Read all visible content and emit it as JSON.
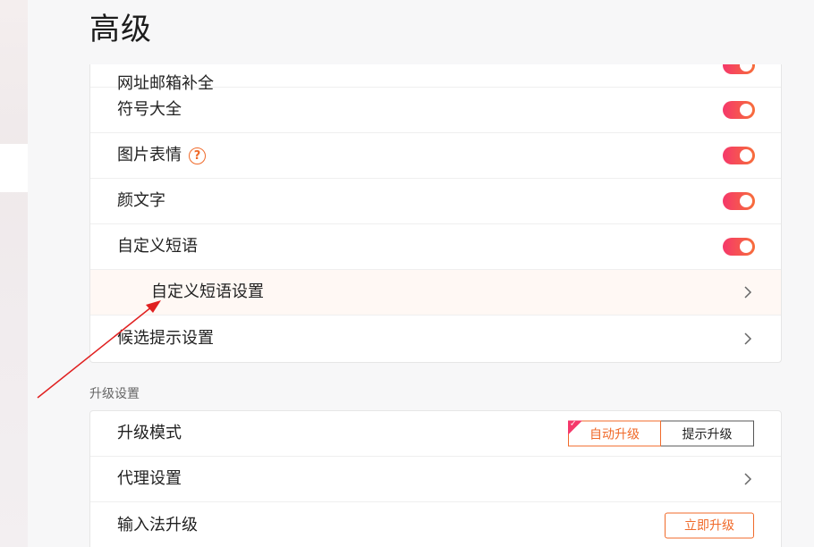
{
  "page": {
    "title": "高级"
  },
  "feature_list": [
    {
      "label": "网址邮箱补全",
      "type": "toggle",
      "on": true
    },
    {
      "label": "符号大全",
      "type": "toggle",
      "on": true
    },
    {
      "label": "图片表情",
      "type": "toggle",
      "on": true,
      "help_icon": "?"
    },
    {
      "label": "颜文字",
      "type": "toggle",
      "on": true
    },
    {
      "label": "自定义短语",
      "type": "toggle",
      "on": true
    },
    {
      "label": "自定义短语设置",
      "type": "link"
    },
    {
      "label": "候选提示设置",
      "type": "link"
    }
  ],
  "upgrade_section": {
    "heading": "升级设置",
    "mode": {
      "label": "升级模式",
      "options": [
        "自动升级",
        "提示升级"
      ],
      "selected": "自动升级"
    },
    "proxy": {
      "label": "代理设置"
    },
    "ime_upgrade": {
      "label": "输入法升级",
      "button": "立即升级"
    }
  },
  "colors": {
    "accent": "#f06a2a",
    "toggle_start": "#f5386a",
    "toggle_end": "#f76e3b",
    "annotation": "#e02020"
  }
}
